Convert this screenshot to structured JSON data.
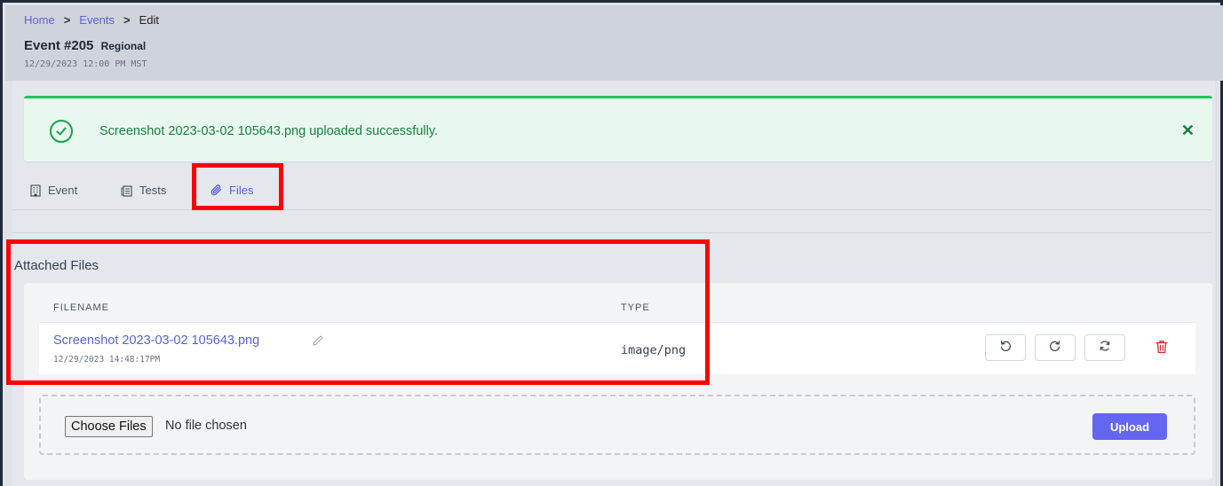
{
  "breadcrumb": {
    "home": "Home",
    "events": "Events",
    "current": "Edit",
    "separator": ">"
  },
  "event": {
    "title": "Event #205",
    "subtitle": "Regional",
    "datetime": "12/29/2023 12:00 PM MST"
  },
  "alert": {
    "message": "Screenshot 2023-03-02 105643.png uploaded successfully.",
    "close": "✕",
    "color": "#22c55e"
  },
  "tabs": [
    {
      "label": "Event",
      "icon": "building-icon"
    },
    {
      "label": "Tests",
      "icon": "clipboard-icon"
    },
    {
      "label": "Files",
      "icon": "paperclip-icon",
      "active": true
    }
  ],
  "files_section": {
    "title": "Attached Files",
    "headers": {
      "filename": "FILENAME",
      "type": "TYPE"
    },
    "rows": [
      {
        "filename": "Screenshot 2023-03-02 105643.png",
        "uploaded": "12/29/2023 14:48:17PM",
        "type": "image/png"
      }
    ]
  },
  "upload": {
    "choose_label": "Choose Files",
    "status": "No file chosen",
    "button": "Upload"
  },
  "colors": {
    "accent": "#5b5fd6",
    "upload_button": "#6366f1",
    "success": "#15803d",
    "danger": "#dc2626",
    "annotation": "#ff0000"
  }
}
